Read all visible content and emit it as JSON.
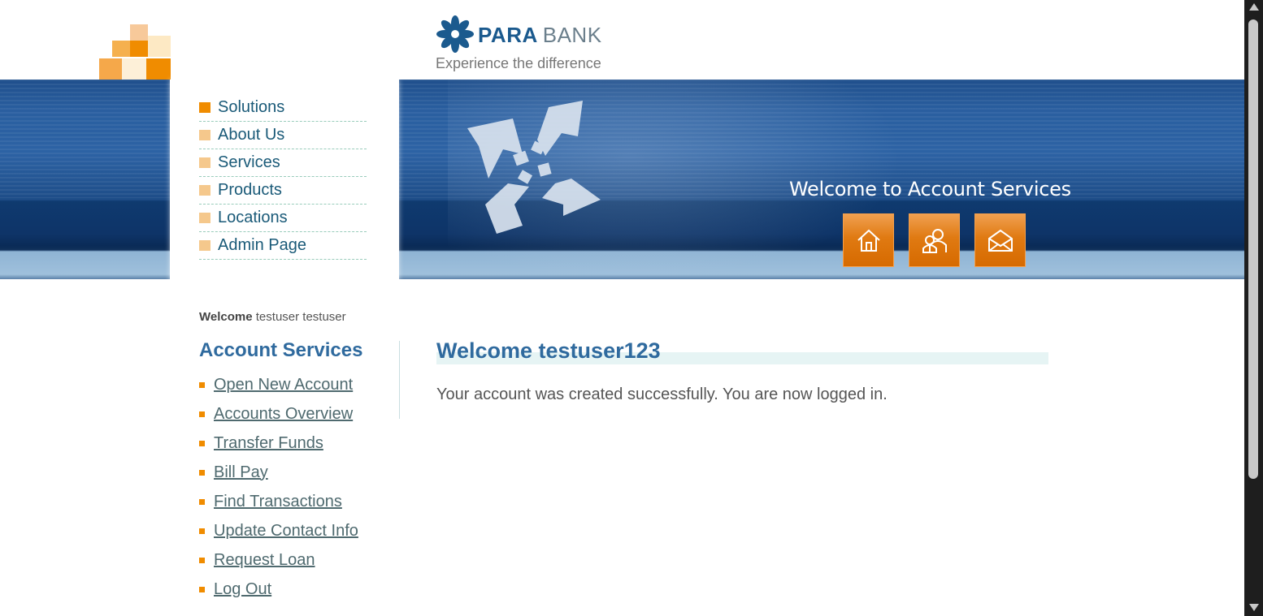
{
  "brand": {
    "name_part1": "PARA",
    "name_part2": "BANK",
    "tagline": "Experience the difference",
    "logo_icon": "parabank-flower-logo-icon"
  },
  "header": {
    "banner_text": "Welcome to Account Services",
    "buttons": [
      {
        "icon": "home-icon"
      },
      {
        "icon": "about-people-icon"
      },
      {
        "icon": "envelope-icon"
      }
    ]
  },
  "top_menu": {
    "items": [
      {
        "label": "Solutions",
        "active": true
      },
      {
        "label": "About Us"
      },
      {
        "label": "Services"
      },
      {
        "label": "Products"
      },
      {
        "label": "Locations"
      },
      {
        "label": "Admin Page"
      }
    ]
  },
  "sidebar": {
    "welcome_bold": "Welcome",
    "welcome_name": "testuser testuser",
    "title": "Account Services",
    "links": [
      {
        "label": "Open New Account"
      },
      {
        "label": "Accounts Overview"
      },
      {
        "label": "Transfer Funds"
      },
      {
        "label": "Bill Pay"
      },
      {
        "label": "Find Transactions"
      },
      {
        "label": "Update Contact Info"
      },
      {
        "label": "Request Loan"
      },
      {
        "label": "Log Out"
      }
    ]
  },
  "main": {
    "title": "Welcome testuser123",
    "message": "Your account was created successfully. You are now logged in."
  },
  "colors": {
    "accent_orange": "#f08c00",
    "title_blue": "#2f6a9e",
    "header_blue": "#1f4f8c"
  }
}
